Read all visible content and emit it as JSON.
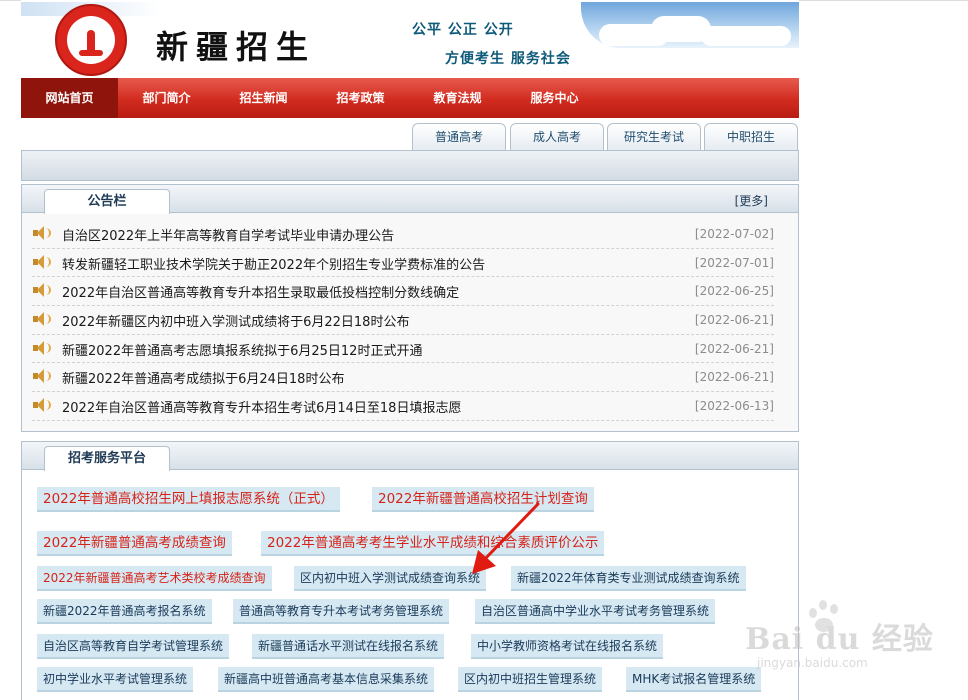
{
  "header": {
    "logo_text": "新疆招生",
    "seal_text": "新疆招生",
    "slogan_line1": "公平  公正  公开",
    "slogan_line2": "方便考生   服务社会"
  },
  "nav": {
    "items": [
      {
        "label": "网站首页",
        "active": true
      },
      {
        "label": "部门简介",
        "active": false
      },
      {
        "label": "招生新闻",
        "active": false
      },
      {
        "label": "招考政策",
        "active": false
      },
      {
        "label": "教育法规",
        "active": false
      },
      {
        "label": "服务中心",
        "active": false
      }
    ]
  },
  "tabs": [
    "普通高考",
    "成人高考",
    "研究生考试",
    "中职招生"
  ],
  "notices": {
    "title": "公告栏",
    "more": "[更多]",
    "items": [
      {
        "title": "自治区2022年上半年高等教育自学考试毕业申请办理公告",
        "date": "[2022-07-02]"
      },
      {
        "title": "转发新疆轻工职业技术学院关于勘正2022年个别招生专业学费标准的公告",
        "date": "[2022-07-01]"
      },
      {
        "title": "2022年自治区普通高等教育专升本招生录取最低投档控制分数线确定",
        "date": "[2022-06-25]"
      },
      {
        "title": "2022年新疆区内初中班入学测试成绩将于6月22日18时公布",
        "date": "[2022-06-21]"
      },
      {
        "title": "新疆2022年普通高考志愿填报系统拟于6月25日12时正式开通",
        "date": "[2022-06-21]"
      },
      {
        "title": "新疆2022年普通高考成绩拟于6月24日18时公布",
        "date": "[2022-06-21]"
      },
      {
        "title": "2022年自治区普通高等教育专升本招生考试6月14日至18日填报志愿",
        "date": "[2022-06-13]"
      }
    ]
  },
  "services": {
    "title": "招考服务平台",
    "items": [
      "2022年普通高校招生网上填报志愿系统（正式）",
      "2022年新疆普通高校招生计划查询",
      "2022年新疆普通高考成绩查询",
      "2022年普通高考考生学业水平成绩和综合素质评价公示",
      "2022年新疆普通高考艺术类校考成绩查询",
      "区内初中班入学测试成绩查询系统",
      "新疆2022年体育类专业测试成绩查询系统",
      "新疆2022年普通高考报名系统",
      "普通高等教育专升本考试考务管理系统",
      "自治区普通高中学业水平考试考务管理系统",
      "自治区高等教育自学考试管理系统",
      "新疆普通话水平测试在线报名系统",
      "中小学教师资格考试在线报名系统",
      "初中学业水平考试管理系统",
      "新疆高中班普通高考基本信息采集系统",
      "区内初中班招生管理系统",
      "MHK考试报名管理系统"
    ]
  },
  "watermark": {
    "brand": "Bai du 经验",
    "url": "jingyan.baidu.com"
  },
  "colors": {
    "nav_red": "#d22b1f",
    "nav_active": "#8e140c",
    "service_bg": "#d6e9f2",
    "service_red_text": "#d6231a",
    "arrow_red": "#e01b12"
  }
}
